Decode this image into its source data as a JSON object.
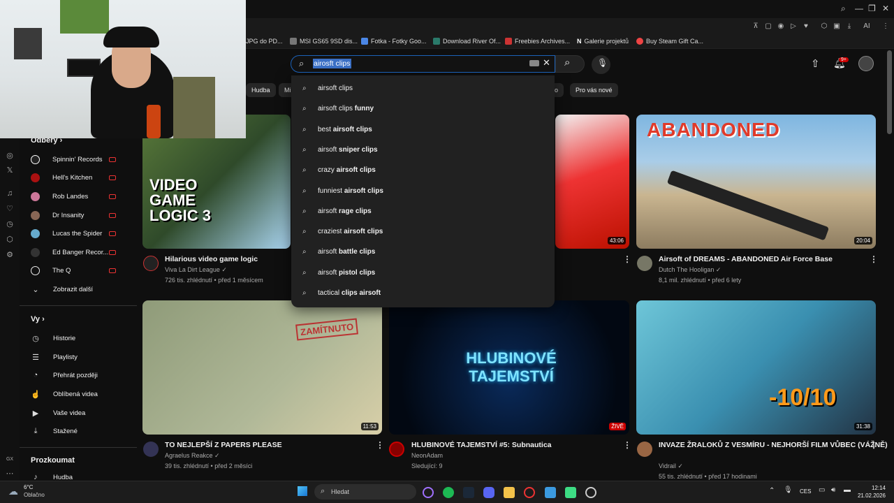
{
  "bookmarks": [
    "JPG do PD...",
    "MSI GS65 9SD dis...",
    "Fotka - Fotky Goo...",
    "Download River Of...",
    "Freebies Archives...",
    "Galerie projektů",
    "Buy Steam Gift Ca..."
  ],
  "search": {
    "value": "airosft clips",
    "suggestions": [
      {
        "typed": "airsoft clips",
        "rest": ""
      },
      {
        "typed": "airsoft clips",
        "rest": " funny"
      },
      {
        "typed": "best ",
        "rest": "airsoft clips"
      },
      {
        "typed": "airsoft ",
        "rest": "sniper clips"
      },
      {
        "typed": "crazy ",
        "rest": "airsoft clips"
      },
      {
        "typed": "funniest ",
        "rest": "airsoft clips"
      },
      {
        "typed": "airsoft ",
        "rest": "rage clips"
      },
      {
        "typed": "craziest ",
        "rest": "airsoft clips"
      },
      {
        "typed": "airsoft ",
        "rest": "battle clips"
      },
      {
        "typed": "airsoft ",
        "rest": "pistol clips"
      },
      {
        "typed": "tactical ",
        "rest": "clips airsoft"
      }
    ]
  },
  "notif_badge": "9+",
  "chips": [
    "Hudba",
    "Mi",
    "o",
    "Pro vás nové"
  ],
  "sidebar": {
    "subs_header": "Odběry",
    "subs": [
      "Spinnin' Records",
      "Hell's Kitchen",
      "Rob Landes",
      "Dr Insanity",
      "Lucas the Spider",
      "Ed Banger Recor...",
      "The Q"
    ],
    "show_more": "Zobrazit další",
    "you_header": "Vy",
    "you_items": [
      "Historie",
      "Playlisty",
      "Přehrát později",
      "Oblíbená videa",
      "Vaše videa",
      "Stažené"
    ],
    "explore_header": "Prozkoumat",
    "explore_items": [
      "Hudba"
    ],
    "rail_label": "GX"
  },
  "videos": [
    {
      "title": "Hilarious video game logic",
      "channel": "Viva La Dirt League",
      "meta": "726 tis. zhlédnutí • před 1 měsícem",
      "duration": "",
      "thumb_text": "VIDEO GAME LOGIC 3"
    },
    {
      "title": "",
      "channel": "",
      "meta": "",
      "duration": "43:06",
      "thumb_text": ""
    },
    {
      "title": "Airsoft of DREAMS - ABANDONED Air Force Base",
      "channel": "Dutch The Hooligan",
      "meta": "8,1 mil. zhlédnutí • před 6 lety",
      "duration": "20:04",
      "thumb_text": "ABANDONED"
    },
    {
      "title": "TO NEJLEPŠÍ Z PAPERS PLEASE",
      "channel": "Agraelus Reakce",
      "meta": "39 tis. zhlédnutí • před 2 měsíci",
      "duration": "11:53",
      "thumb_text": "ZAMÍTNUTO"
    },
    {
      "title": "HLUBINOVÉ TAJEMSTVÍ #5: Subnautica",
      "channel": "NeonAdam",
      "meta": "Sledující: 9",
      "duration": "ŽIVĚ",
      "thumb_text": "HLUBINOVÉ TAJEMSTVÍ"
    },
    {
      "title": "INVAZE ŽRALOKŮ Z VESMÍRU - NEJHORŠÍ FILM VŮBEC (VÁŽNĚ)",
      "channel": "Vidrail",
      "meta": "55 tis. zhlédnutí • před 17 hodinami",
      "duration": "31:38",
      "thumb_text": "-10/10"
    }
  ],
  "taskbar": {
    "weather_temp": "6°C",
    "weather_desc": "Oblačno",
    "search_placeholder": "Hledat",
    "lang": "CES",
    "time": "12:14",
    "date": "21.02.2026"
  },
  "colors": {
    "accent": "#3ea6ff",
    "live": "#cc0000",
    "bg": "#0f0f0f"
  }
}
